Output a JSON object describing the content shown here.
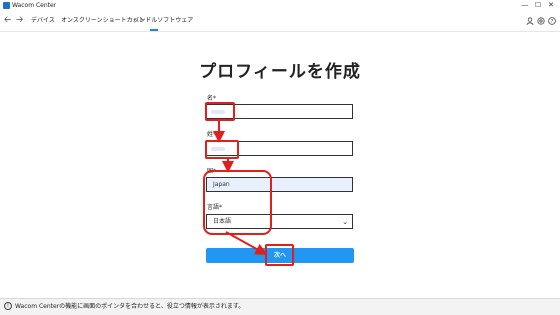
{
  "window": {
    "title": "Wacom Center",
    "controls": {
      "minimize": "—",
      "maximize": "☐",
      "close": "✕"
    }
  },
  "nav": {
    "back_icon": "arrow-left-icon",
    "forward_icon": "arrow-right-icon",
    "tabs": [
      {
        "label": "デバイス"
      },
      {
        "label": "オンスクリーンショートカット"
      },
      {
        "label": "バンドルソフトウェア"
      }
    ],
    "active_tab": 2,
    "utility_icons": [
      "user-icon",
      "settings-icon",
      "help-icon"
    ]
  },
  "form": {
    "title": "プロフィールを作成",
    "first_name": {
      "label": "名*",
      "value": ""
    },
    "last_name": {
      "label": "姓*",
      "value": ""
    },
    "country": {
      "label": "国*",
      "value": "Japan"
    },
    "language": {
      "label": "言語*",
      "value": "日本語"
    },
    "next_button": "次へ"
  },
  "status_bar": {
    "icon": "info-icon",
    "text": "Wacom Centerの機能に画面のポインタを合わせると、役立つ情報が表示されます。"
  },
  "colors": {
    "accent": "#2196f3",
    "annotation": "#e0201c"
  }
}
